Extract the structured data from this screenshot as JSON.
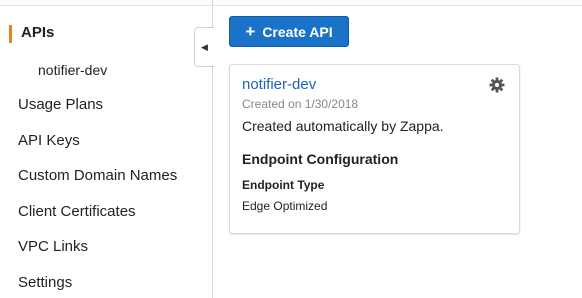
{
  "sidebar": {
    "items": [
      {
        "label": "APIs"
      },
      {
        "label": "notifier-dev"
      },
      {
        "label": "Usage Plans"
      },
      {
        "label": "API Keys"
      },
      {
        "label": "Custom Domain Names"
      },
      {
        "label": "Client Certificates"
      },
      {
        "label": "VPC Links"
      },
      {
        "label": "Settings"
      }
    ],
    "collapse_icon": "caret-left-icon",
    "active_color": "#e8831c"
  },
  "toolbar": {
    "create_label": "Create API",
    "create_icon": "plus-icon",
    "button_color": "#1a73c9"
  },
  "api_card": {
    "name": "notifier-dev",
    "created": "Created on 1/30/2018",
    "description": "Created automatically by Zappa.",
    "endpoint_heading": "Endpoint Configuration",
    "endpoint_type_label": "Endpoint Type",
    "endpoint_type_value": "Edge Optimized",
    "settings_icon": "gear-icon",
    "link_color": "#1d65b5"
  }
}
